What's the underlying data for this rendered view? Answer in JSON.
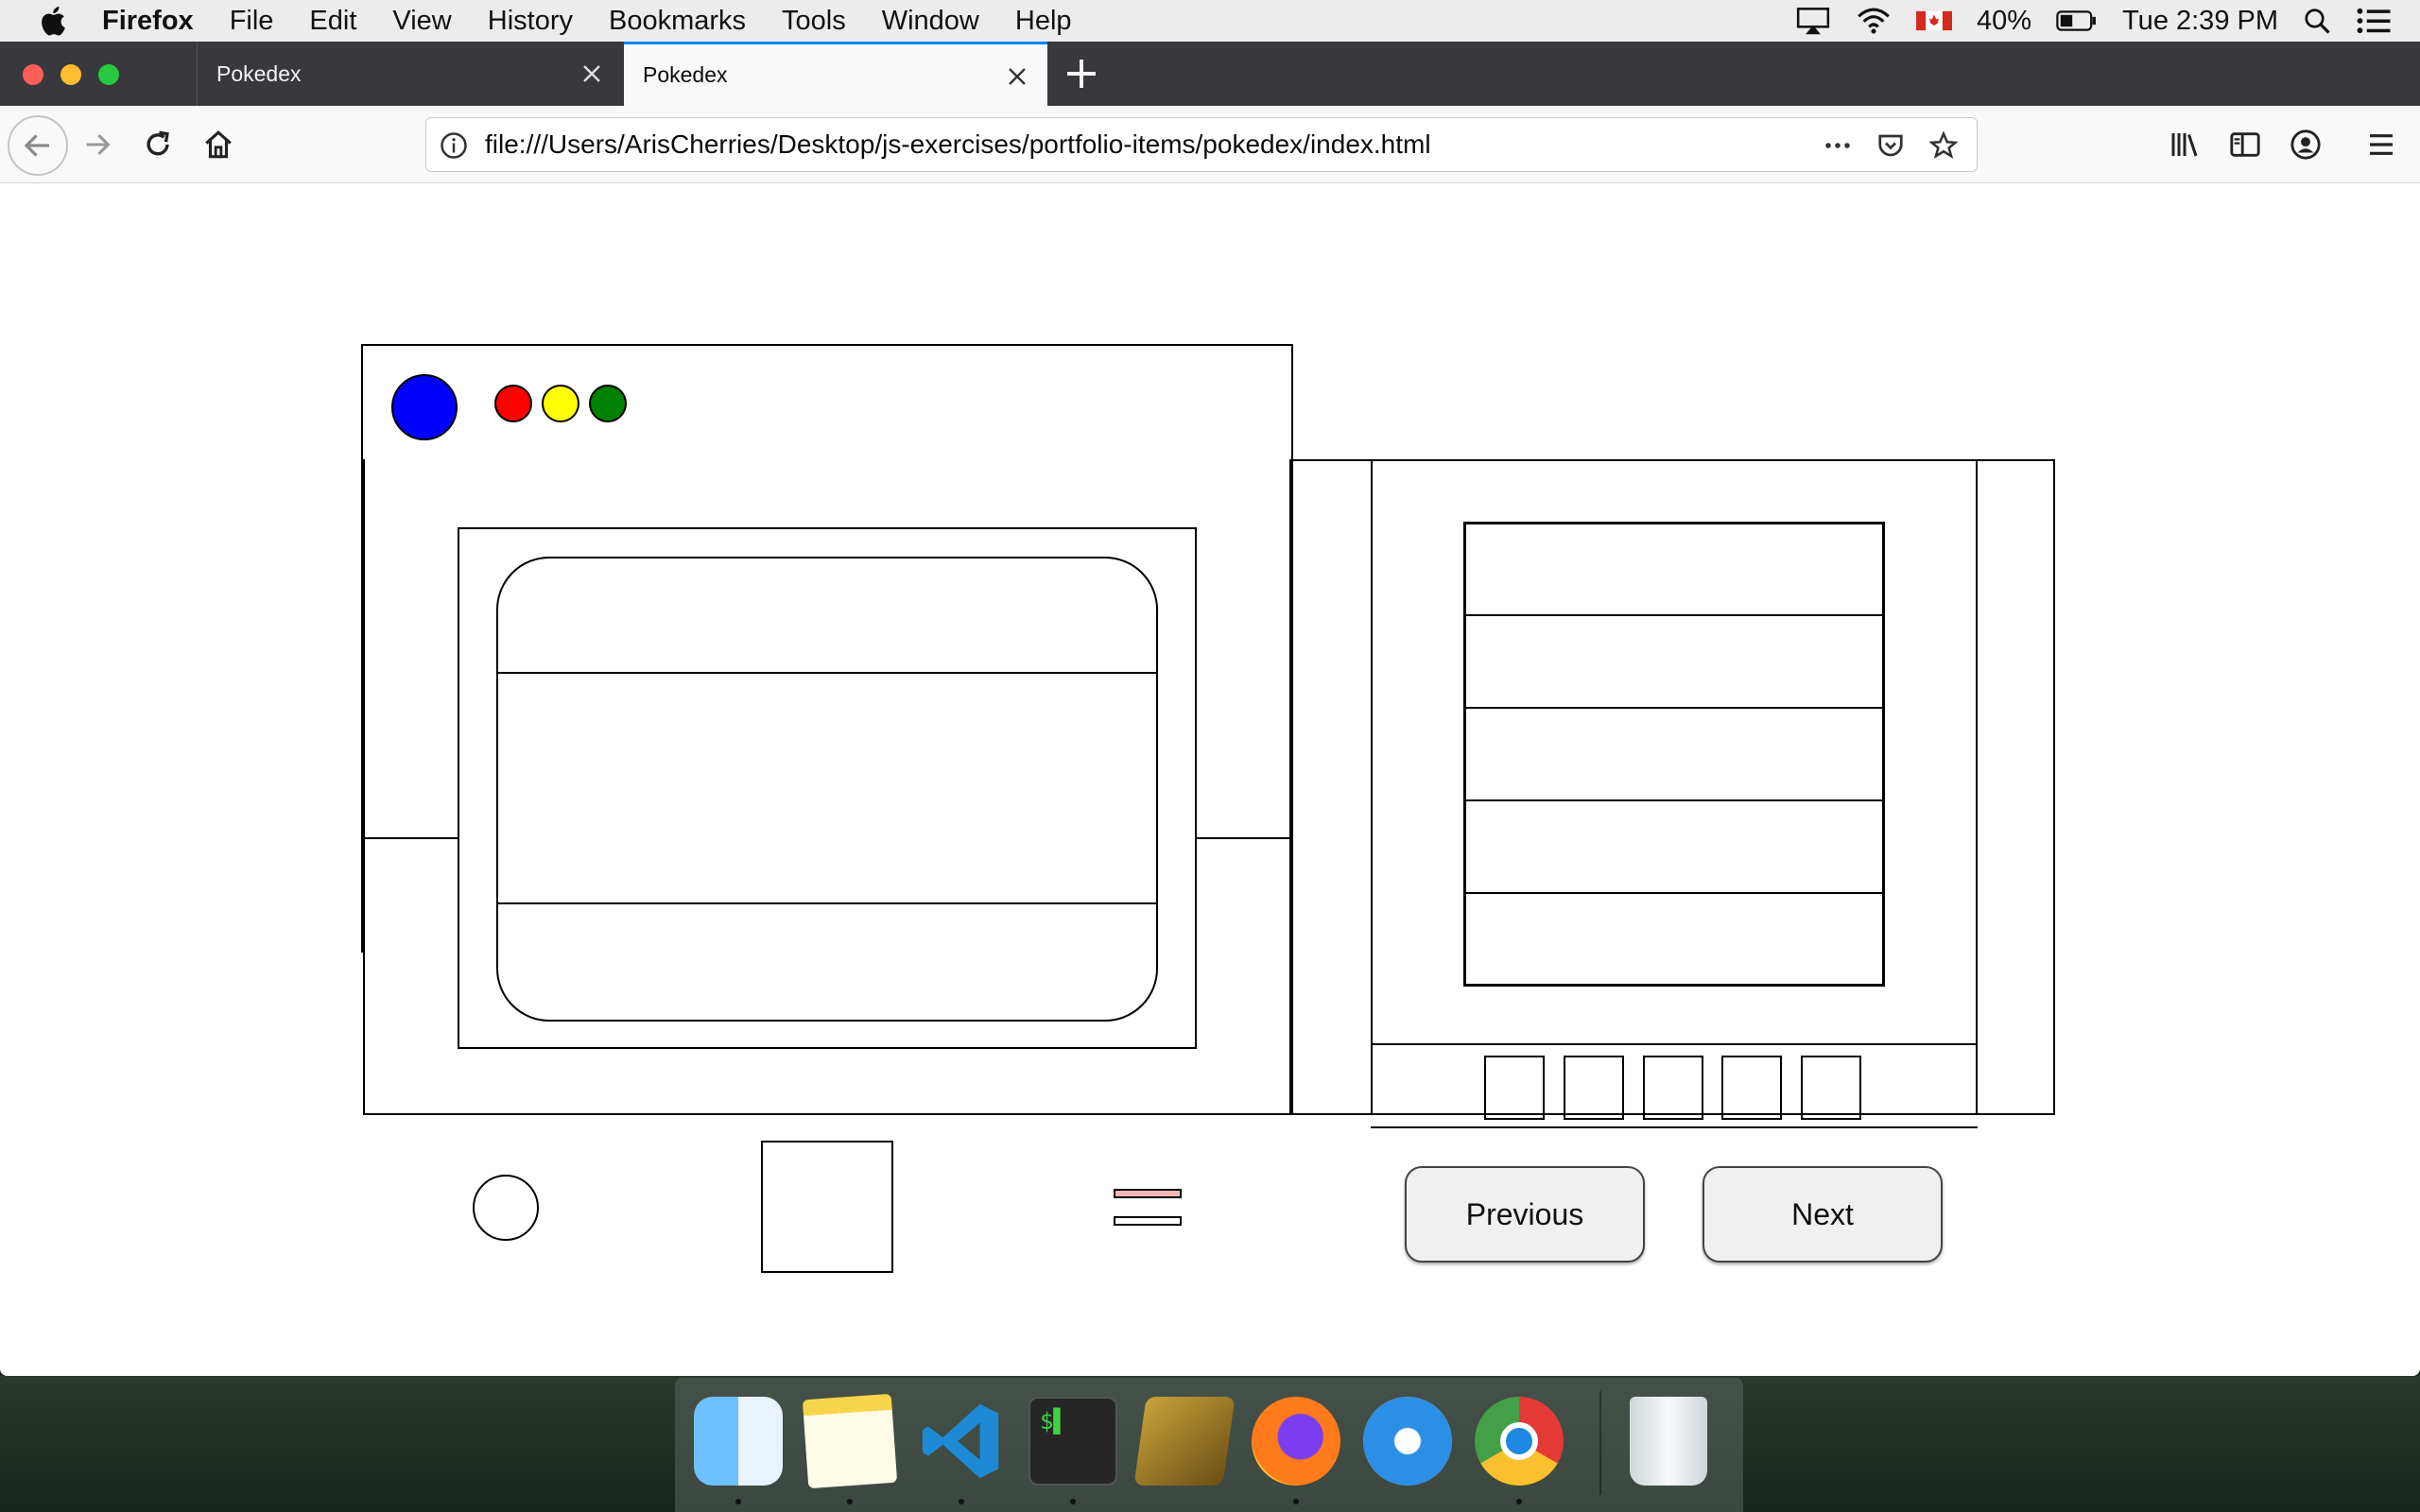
{
  "menubar": {
    "app_name": "Firefox",
    "items": [
      "File",
      "Edit",
      "View",
      "History",
      "Bookmarks",
      "Tools",
      "Window",
      "Help"
    ],
    "battery": "40%",
    "clock": "Tue 2:39 PM"
  },
  "browser": {
    "tabs": [
      {
        "label": "Pokedex",
        "active": false
      },
      {
        "label": "Pokedex",
        "active": true
      }
    ],
    "url": "file:///Users/ArisCherries/Desktop/js-exercises/portfolio-items/pokedex/index.html"
  },
  "pokedex": {
    "lights": {
      "big": "#0000ff",
      "small": [
        "#ff0000",
        "#ffff00",
        "#008000"
      ]
    },
    "buttons": {
      "previous": "Previous",
      "next": "Next"
    },
    "list_rows": 5,
    "mini_squares": 5,
    "stripe_color": "#f4b8b8"
  },
  "dock": {
    "apps": [
      "Finder",
      "Notes",
      "Visual Studio Code",
      "Terminal",
      "FileZilla",
      "Firefox",
      "Safari",
      "Google Chrome",
      "Trash"
    ]
  }
}
